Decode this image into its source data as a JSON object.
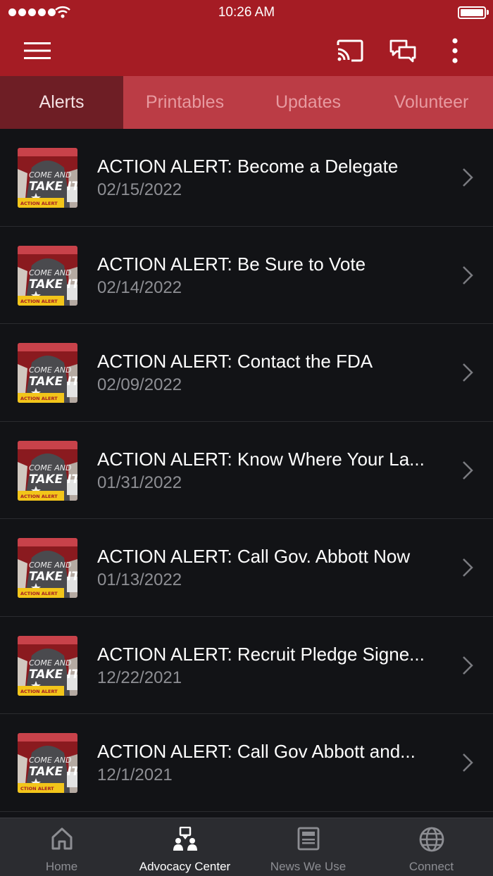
{
  "status_bar": {
    "time": "10:26 AM"
  },
  "app_bar": {
    "icons": [
      "menu-icon",
      "cast-icon",
      "chat-icon",
      "more-vertical-icon"
    ]
  },
  "tabs": [
    {
      "label": "Alerts",
      "active": true
    },
    {
      "label": "Printables",
      "active": false
    },
    {
      "label": "Updates",
      "active": false
    },
    {
      "label": "Volunteer",
      "active": false
    }
  ],
  "alerts": [
    {
      "title": "ACTION ALERT:  Become a Delegate",
      "date": "02/15/2022",
      "thumb_label": "ACTION ALERT"
    },
    {
      "title": "ACTION ALERT:  Be Sure to Vote",
      "date": "02/14/2022",
      "thumb_label": "ACTION ALERT"
    },
    {
      "title": "ACTION ALERT:  Contact the FDA",
      "date": "02/09/2022",
      "thumb_label": "ACTION ALERT"
    },
    {
      "title": "ACTION ALERT:  Know Where Your La...",
      "date": "01/31/2022",
      "thumb_label": "ACTION ALERT"
    },
    {
      "title": "ACTION ALERT:  Call Gov. Abbott Now",
      "date": "01/13/2022",
      "thumb_label": "ACTION ALERT"
    },
    {
      "title": "ACTION ALERT:  Recruit Pledge Signe...",
      "date": "12/22/2021",
      "thumb_label": "ACTION ALERT"
    },
    {
      "title": "ACTION ALERT:  Call Gov Abbott and...",
      "date": "12/1/2021",
      "thumb_label": "CTION ALERT"
    }
  ],
  "bottom_nav": [
    {
      "label": "Home",
      "icon": "home-icon",
      "active": false
    },
    {
      "label": "Advocacy Center",
      "icon": "advocacy-icon",
      "active": true
    },
    {
      "label": "News We Use",
      "icon": "news-icon",
      "active": false
    },
    {
      "label": "Connect",
      "icon": "globe-icon",
      "active": false
    }
  ],
  "colors": {
    "brand_red": "#a51c24",
    "tab_strip": "#bb3c45",
    "tab_active": "#6e1e25",
    "list_bg": "#121316",
    "nav_bg": "#2b2c30"
  }
}
